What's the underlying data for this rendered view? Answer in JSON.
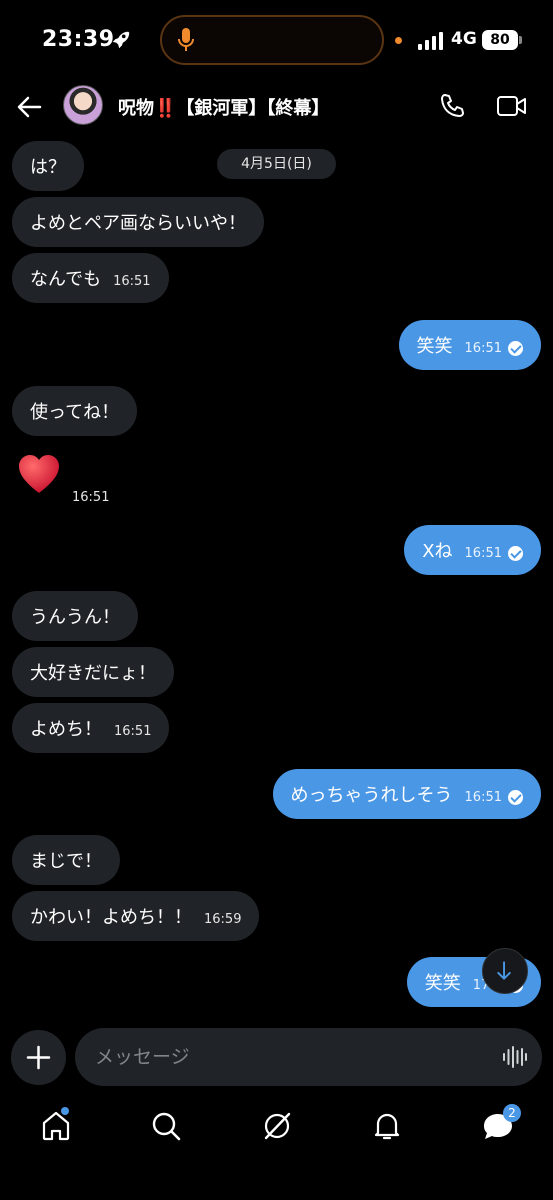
{
  "status": {
    "time": "23:39",
    "network": "4G",
    "battery": "80"
  },
  "header": {
    "title": "呪物‼️【銀河軍】【終幕】"
  },
  "date_chip": "4月5日(日)",
  "messages": [
    {
      "dir": "in",
      "text": "は？"
    },
    {
      "dir": "in",
      "text": "よめとペア画ならいいや！"
    },
    {
      "dir": "in",
      "text": "なんでも",
      "time": "16:51"
    },
    {
      "dir": "out",
      "text": "笑笑",
      "time": "16:51"
    },
    {
      "dir": "in",
      "text": "使ってね！"
    },
    {
      "dir": "in",
      "text": "❤️",
      "time": "16:51"
    },
    {
      "dir": "out",
      "text": "Xね",
      "time": "16:51"
    },
    {
      "dir": "in",
      "text": "うんうん！"
    },
    {
      "dir": "in",
      "text": "大好きだにょ！"
    },
    {
      "dir": "in",
      "text": "よめち！",
      "time": "16:51"
    },
    {
      "dir": "out",
      "text": "めっちゃうれしそう",
      "time": "16:51"
    },
    {
      "dir": "in",
      "text": "まじで！"
    },
    {
      "dir": "in",
      "text": "かわい！よめち！！",
      "time": "16:59"
    },
    {
      "dir": "out",
      "text": "笑笑",
      "time": "17:0"
    }
  ],
  "composer": {
    "placeholder": "メッセージ"
  },
  "nav": {
    "messages_badge": "2"
  },
  "colors": {
    "outgoing_bubble": "#4a97e6",
    "incoming_bubble": "#202327",
    "background": "#000000"
  },
  "icons": [
    "rocket-icon",
    "mic-icon",
    "signal-icon",
    "back-arrow-icon",
    "phone-icon",
    "video-icon",
    "heart-icon",
    "arrow-down-icon",
    "plus-icon",
    "waveform-icon",
    "home-icon",
    "search-icon",
    "grok-icon",
    "bell-icon",
    "messages-icon"
  ]
}
